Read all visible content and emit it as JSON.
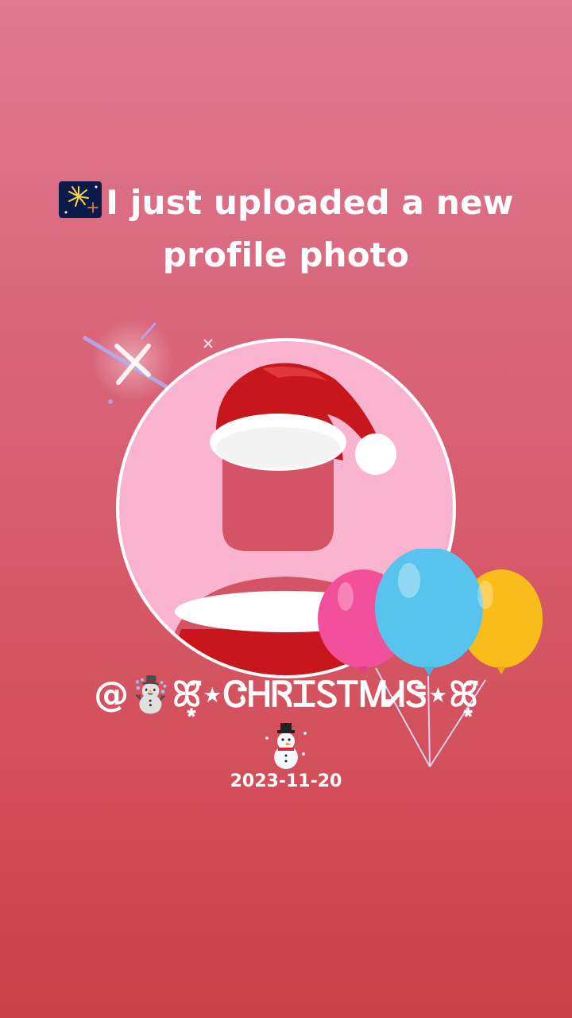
{
  "headline": {
    "icon": "fireworks-icon",
    "text": "I just uploaded a new profile photo"
  },
  "profile": {
    "username": "@☃️ꕤ͙̈⋆ᏣᎻᏒᏆᏚᎢᎷᏗᏕ⋆ꕤ͙̈",
    "username_icon": "snowman-icon",
    "date": "2023-11-20"
  },
  "decorations": {
    "hat_color": "#c8161d",
    "balloon_colors": [
      "#f2509a",
      "#58c3ec",
      "#f8bd1a"
    ]
  }
}
